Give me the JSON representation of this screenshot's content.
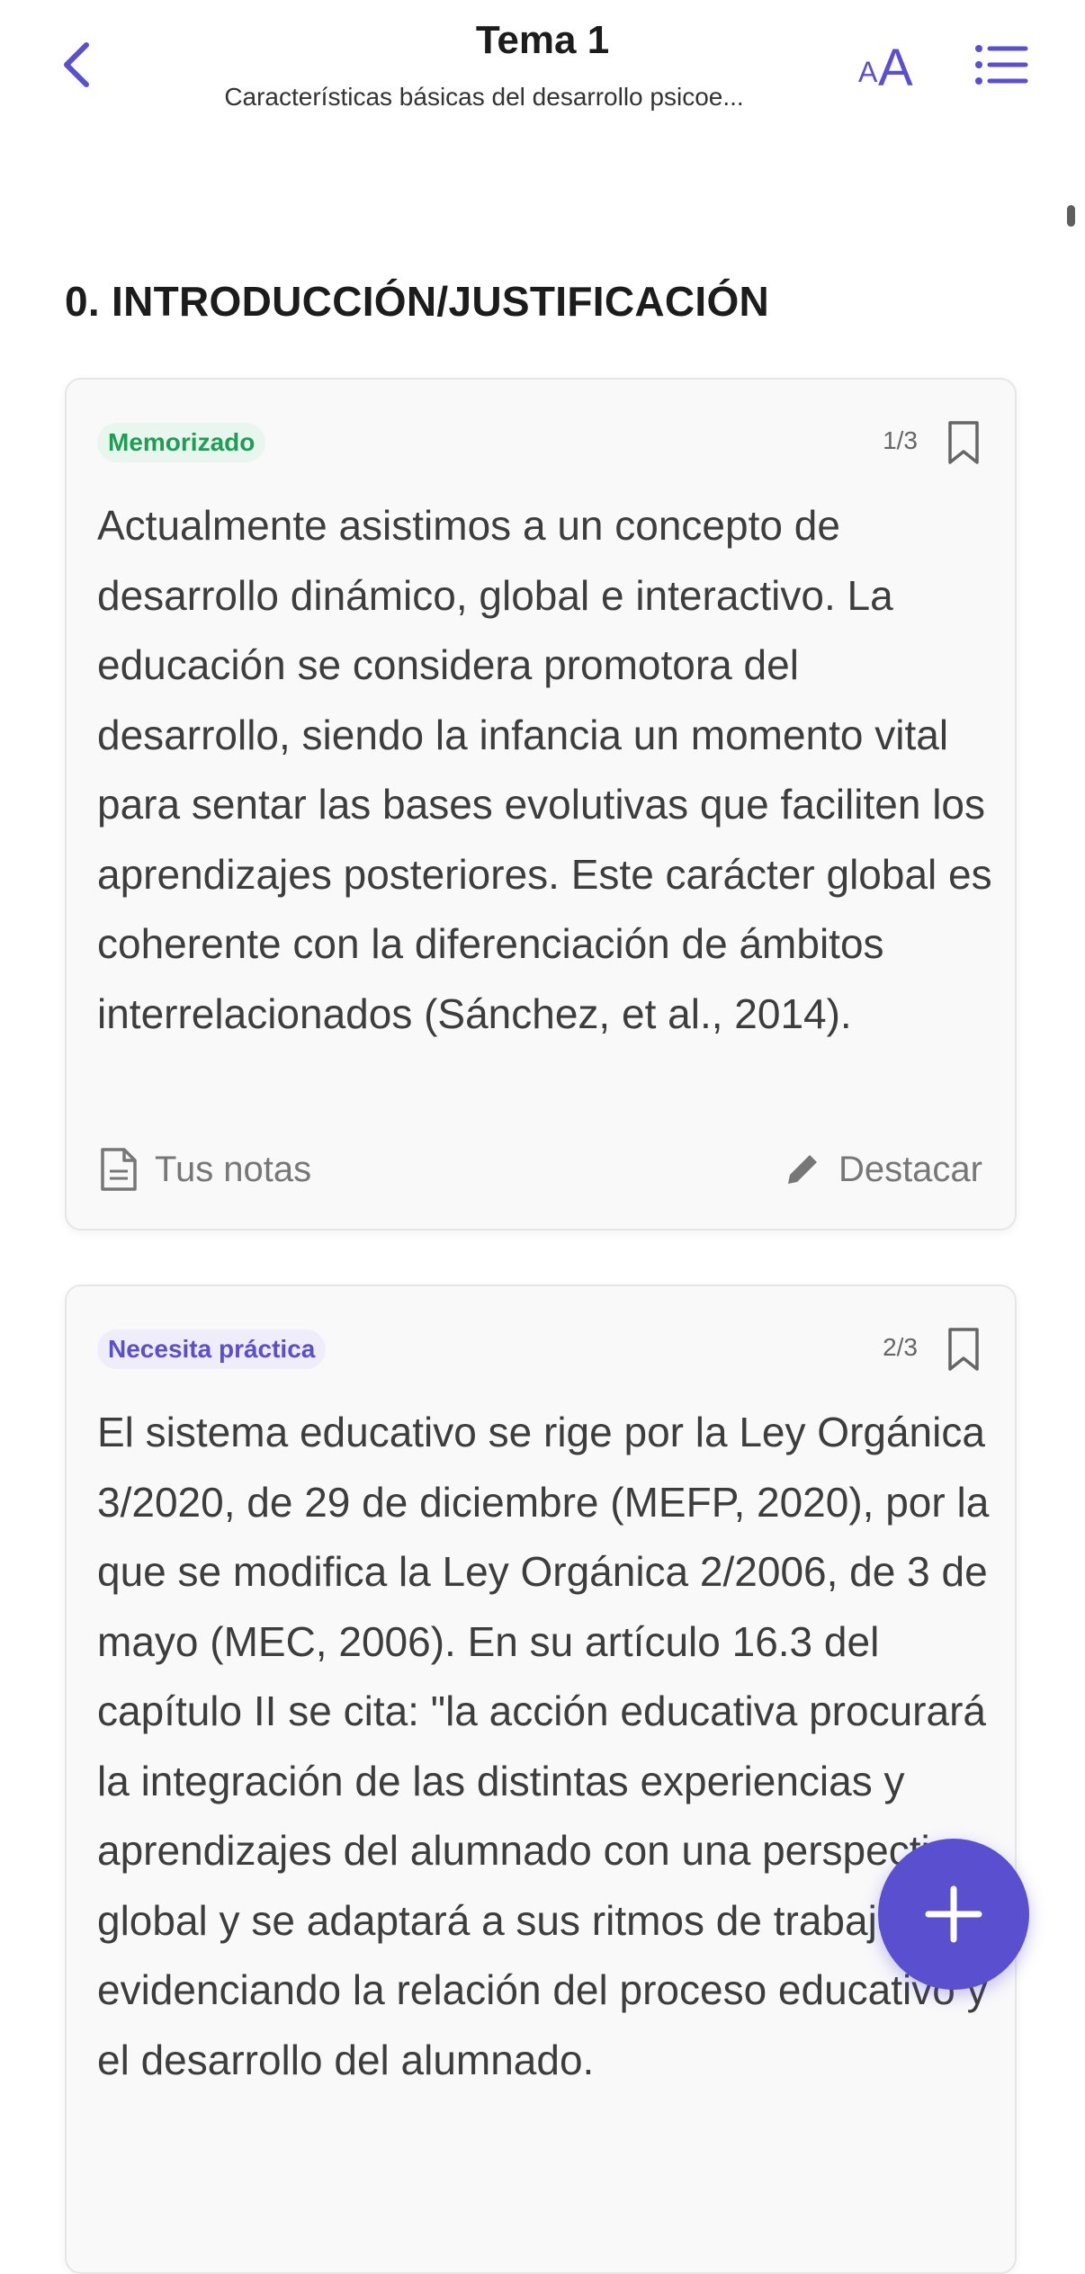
{
  "header": {
    "title": "Tema 1",
    "subtitle": "Características básicas del desarrollo psicoe...",
    "font_small": "A",
    "font_big": "A"
  },
  "section": {
    "title": "0. INTRODUCCIÓN/JUSTIFICACIÓN"
  },
  "cards": [
    {
      "status": "Memorizado",
      "counter": "1/3",
      "text": "Actualmente asistimos a un concepto de desarrollo dinámico, global e interactivo. La educación se considera promotora del desarrollo, siendo la infancia un momento vital para sentar las bases evolutivas que faciliten los aprendizajes posteriores. Este carácter global es coherente con la diferenciación de ámbitos interrelacionados (Sánchez, et al., 2014).",
      "notes_label": "Tus notas",
      "highlight_label": "Destacar"
    },
    {
      "status": "Necesita práctica",
      "counter": "2/3",
      "text": "El sistema educativo se rige por la Ley Orgánica 3/2020, de 29 de diciembre (MEFP, 2020), por la que se modifica la Ley Orgánica 2/2006, de 3 de mayo (MEC, 2006). En su artículo 16.3 del capítulo II se cita: \"la acción educativa procurará la integración de las distintas experiencias y aprendizajes del alumnado con una perspectiva global y se adaptará a sus ritmos de trabajo\", evidenciando la relación del proceso educativo y el desarrollo del alumnado."
    }
  ],
  "colors": {
    "accent": "#5a4fcf",
    "memorized": "#1f9d55",
    "practice": "#5a4fcf"
  }
}
